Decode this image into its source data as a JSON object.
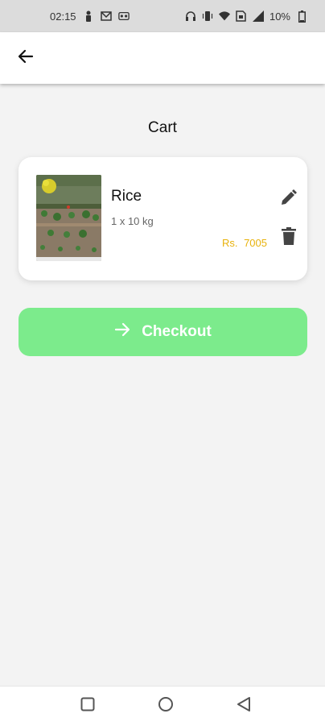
{
  "status_bar": {
    "time": "02:15",
    "battery": "10%",
    "left_icons": [
      "person-icon",
      "mail-icon",
      "voicemail-icon"
    ],
    "right_icons": [
      "headphones-icon",
      "vibrate-icon",
      "wifi-icon",
      "sim-icon",
      "signal-icon",
      "battery-icon"
    ]
  },
  "app_bar": {
    "back_icon": "arrow-left-icon"
  },
  "page": {
    "title": "Cart"
  },
  "cart": {
    "items": [
      {
        "name": "Rice",
        "quantity": "1 x 10 kg",
        "price": "Rs. 7005",
        "actions": {
          "edit_icon": "pencil-icon",
          "delete_icon": "trash-icon"
        }
      }
    ]
  },
  "checkout": {
    "label": "Checkout",
    "icon": "arrow-right-icon"
  },
  "colors": {
    "accent": "#7ceb8c",
    "price": "#e8b20c",
    "background": "#f3f3f3"
  },
  "nav_bar": {
    "buttons": [
      "recents-square-icon",
      "home-circle-icon",
      "back-triangle-icon"
    ]
  }
}
